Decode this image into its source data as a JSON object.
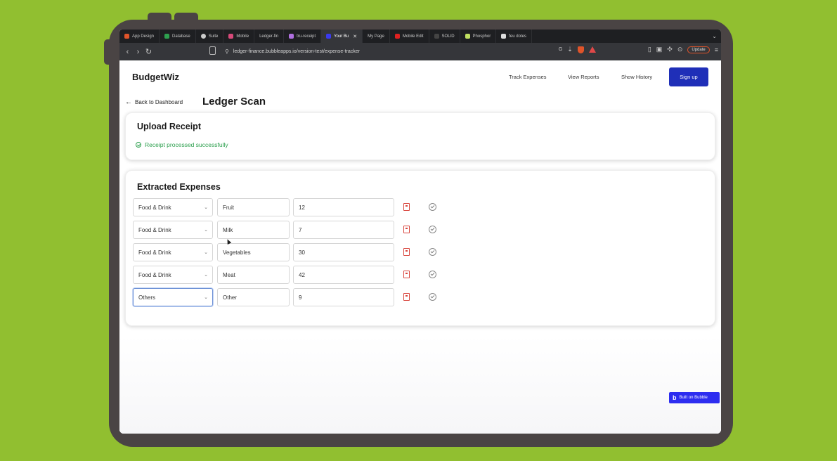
{
  "browser": {
    "tabs": [
      {
        "label": "App Design",
        "color": "#e0542a"
      },
      {
        "label": "Database",
        "color": "#2ea04f"
      },
      {
        "label": "Suite",
        "color": "#cccccc"
      },
      {
        "label": "Mobile",
        "color": "#d84a7a"
      },
      {
        "label": "Ledger-fin",
        "color": "#888888"
      },
      {
        "label": "tru-receipt",
        "color": "#b070e0"
      },
      {
        "label": "Your Bu",
        "color": "#3a3af0",
        "active": true
      },
      {
        "label": "My Page",
        "color": "#555555"
      },
      {
        "label": "Mobile Edit",
        "color": "#e02020"
      },
      {
        "label": "SOLID",
        "color": "#444444"
      },
      {
        "label": "Phosphor",
        "color": "#c0e060"
      },
      {
        "label": "feu dotes",
        "color": "#dddddd"
      }
    ],
    "url": "ledger-finance.bubbleapps.io/version-test/expense-tracker",
    "update_label": "Update"
  },
  "header": {
    "brand": "BudgetWiz",
    "nav": [
      "Track Expenses",
      "View Reports",
      "Show History"
    ],
    "signup_label": "Sign up"
  },
  "subheader": {
    "back_label": "Back to Dashboard",
    "title": "Ledger Scan"
  },
  "upload": {
    "title": "Upload Receipt",
    "status": "Receipt processed successfully"
  },
  "expenses": {
    "title": "Extracted Expenses",
    "rows": [
      {
        "category": "Food & Drink",
        "description": "Fruit",
        "amount": "12"
      },
      {
        "category": "Food & Drink",
        "description": "Milk",
        "amount": "7"
      },
      {
        "category": "Food & Drink",
        "description": "Vegetables",
        "amount": "30"
      },
      {
        "category": "Food & Drink",
        "description": "Meat",
        "amount": "42"
      },
      {
        "category": "Others",
        "description": "Other",
        "amount": "9"
      }
    ]
  },
  "badge": {
    "label": "Built on Bubble"
  },
  "colors": {
    "accent": "#1f2fb8",
    "success": "#2ea04f",
    "danger": "#d9473f",
    "background": "#91bf30"
  }
}
